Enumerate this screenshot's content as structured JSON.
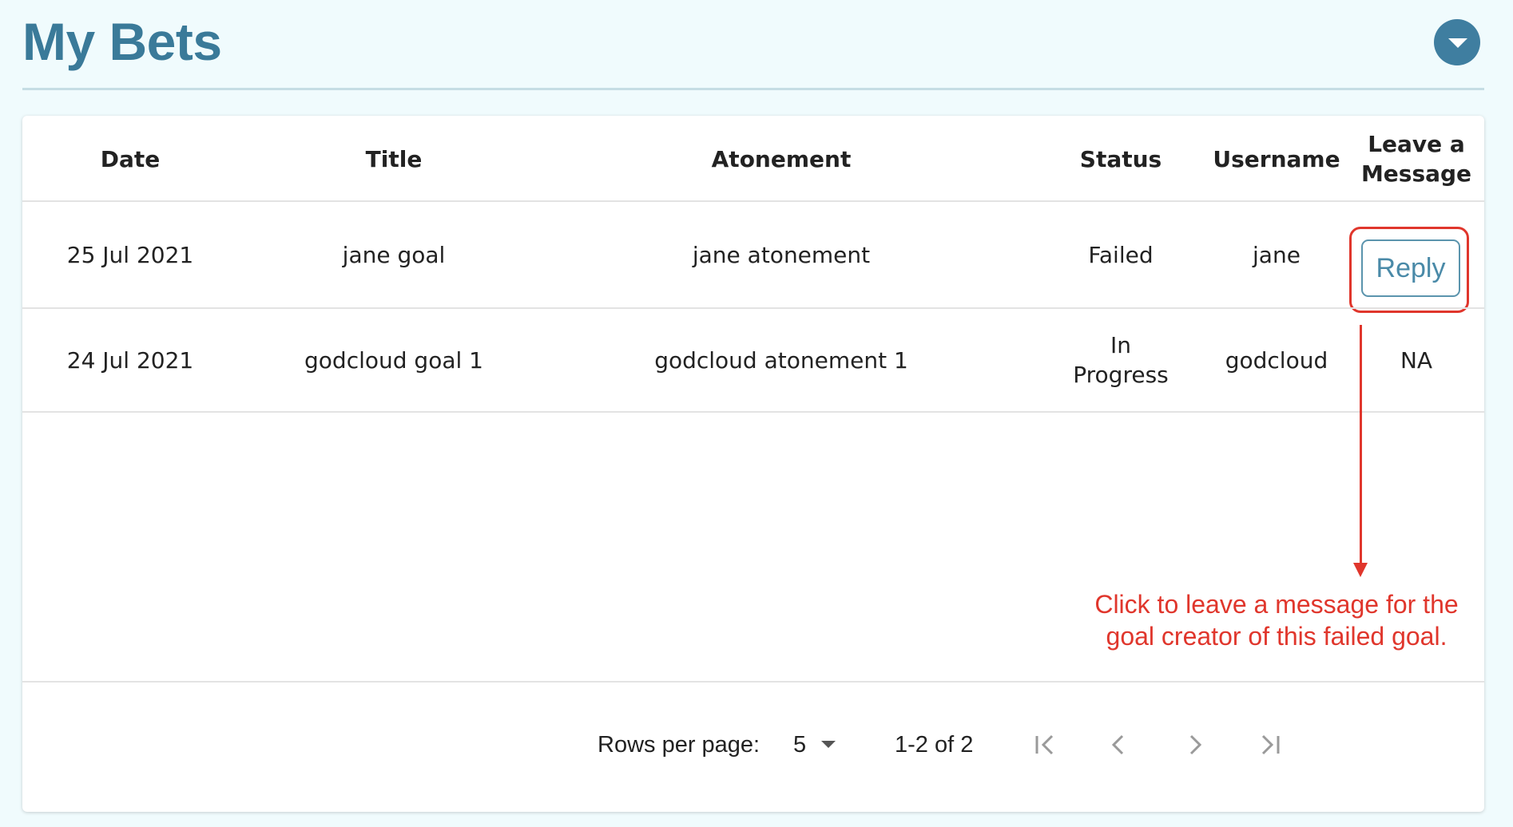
{
  "header": {
    "title": "My Bets",
    "collapse_icon": "chevron-down-icon"
  },
  "table": {
    "columns": [
      "Date",
      "Title",
      "Atonement",
      "Status",
      "Username",
      "Leave a Message"
    ],
    "rows": [
      {
        "date": "25 Jul 2021",
        "title": "jane goal",
        "atonement": "jane atonement",
        "status": "Failed",
        "username": "jane",
        "message": "Reply"
      },
      {
        "date": "24 Jul 2021",
        "title": "godcloud goal 1",
        "atonement": "godcloud atonement 1",
        "status": "In Progress",
        "username": "godcloud",
        "message": "NA"
      }
    ]
  },
  "annotation": {
    "text": "Click to leave a message for the goal creator of this failed goal.",
    "color": "#e0362c"
  },
  "footer": {
    "rows_per_page_label": "Rows per page:",
    "rows_per_page_value": "5",
    "page_range": "1-2 of 2"
  },
  "colors": {
    "accent": "#3a7a99",
    "background": "#f0fbfd"
  }
}
